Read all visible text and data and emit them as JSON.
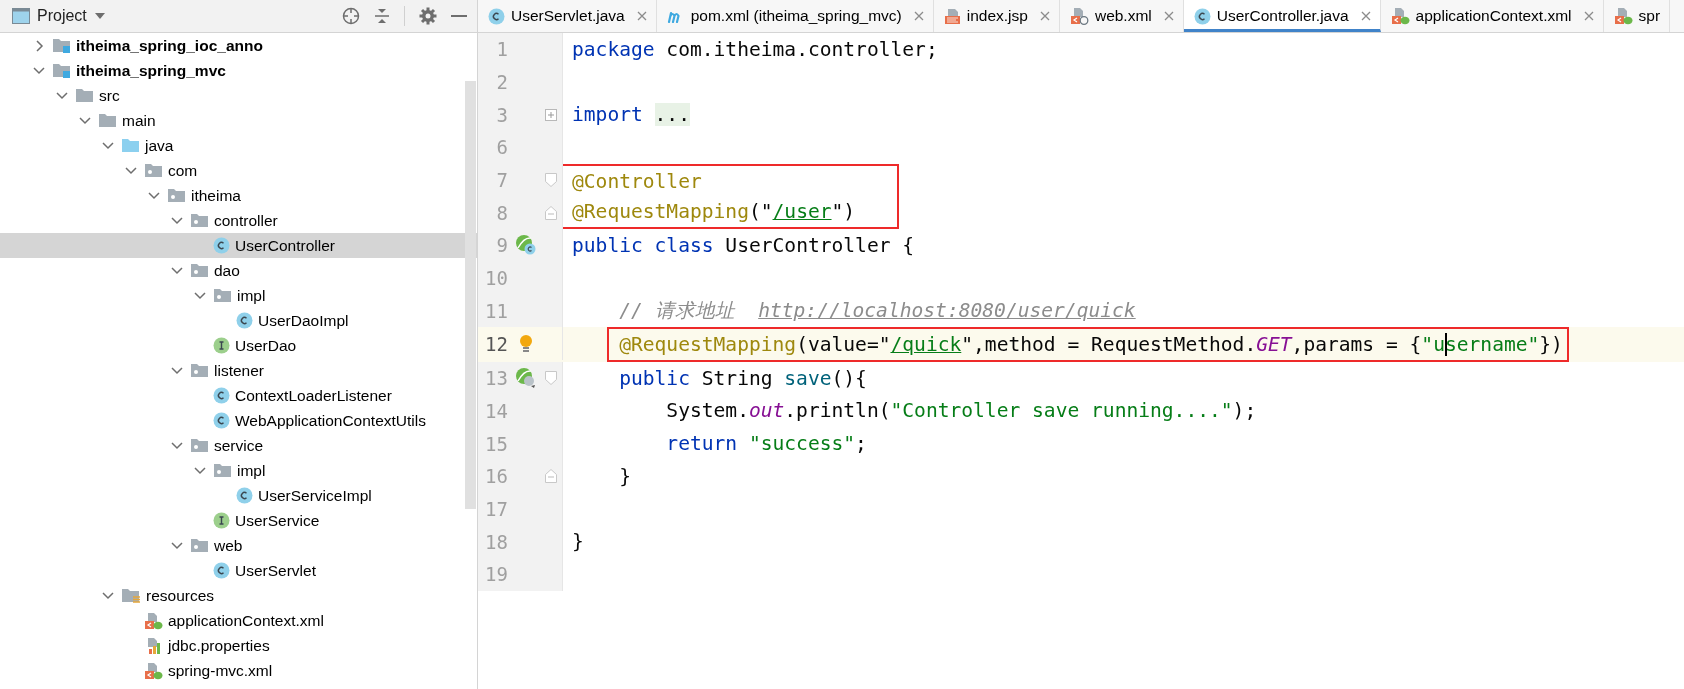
{
  "project_panel": {
    "title": "Project",
    "tree": [
      {
        "label": "itheima_spring_ioc_anno",
        "kind": "module",
        "expanded": false,
        "selected": false
      },
      {
        "label": "itheima_spring_mvc",
        "kind": "module",
        "expanded": true,
        "selected": false,
        "children": [
          {
            "label": "src",
            "kind": "folder",
            "expanded": true,
            "selected": false,
            "children": [
              {
                "label": "main",
                "kind": "folder",
                "expanded": true,
                "selected": false,
                "children": [
                  {
                    "label": "java",
                    "kind": "source-root",
                    "expanded": true,
                    "selected": false,
                    "children": [
                      {
                        "label": "com",
                        "kind": "package",
                        "expanded": true,
                        "selected": false,
                        "children": [
                          {
                            "label": "itheima",
                            "kind": "package",
                            "expanded": true,
                            "selected": false,
                            "children": [
                              {
                                "label": "controller",
                                "kind": "package",
                                "expanded": true,
                                "selected": false,
                                "children": [
                                  {
                                    "label": "UserController",
                                    "kind": "class",
                                    "selected": true
                                  }
                                ]
                              },
                              {
                                "label": "dao",
                                "kind": "package",
                                "expanded": true,
                                "selected": false,
                                "children": [
                                  {
                                    "label": "impl",
                                    "kind": "package",
                                    "expanded": true,
                                    "selected": false,
                                    "children": [
                                      {
                                        "label": "UserDaoImpl",
                                        "kind": "class",
                                        "selected": false
                                      }
                                    ]
                                  },
                                  {
                                    "label": "UserDao",
                                    "kind": "interface",
                                    "selected": false
                                  }
                                ]
                              },
                              {
                                "label": "listener",
                                "kind": "package",
                                "expanded": true,
                                "selected": false,
                                "children": [
                                  {
                                    "label": "ContextLoaderListener",
                                    "kind": "class",
                                    "selected": false
                                  },
                                  {
                                    "label": "WebApplicationContextUtils",
                                    "kind": "class",
                                    "selected": false
                                  }
                                ]
                              },
                              {
                                "label": "service",
                                "kind": "package",
                                "expanded": true,
                                "selected": false,
                                "children": [
                                  {
                                    "label": "impl",
                                    "kind": "package",
                                    "expanded": true,
                                    "selected": false,
                                    "children": [
                                      {
                                        "label": "UserServiceImpl",
                                        "kind": "class",
                                        "selected": false
                                      }
                                    ]
                                  },
                                  {
                                    "label": "UserService",
                                    "kind": "interface",
                                    "selected": false
                                  }
                                ]
                              },
                              {
                                "label": "web",
                                "kind": "package",
                                "expanded": true,
                                "selected": false,
                                "children": [
                                  {
                                    "label": "UserServlet",
                                    "kind": "class",
                                    "selected": false
                                  }
                                ]
                              }
                            ]
                          }
                        ]
                      }
                    ]
                  },
                  {
                    "label": "resources",
                    "kind": "resource-root",
                    "expanded": true,
                    "selected": false,
                    "children": [
                      {
                        "label": "applicationContext.xml",
                        "kind": "spring-xml",
                        "selected": false
                      },
                      {
                        "label": "jdbc.properties",
                        "kind": "properties",
                        "selected": false
                      },
                      {
                        "label": "spring-mvc.xml",
                        "kind": "spring-xml",
                        "selected": false
                      }
                    ]
                  }
                ]
              }
            ]
          }
        ]
      }
    ]
  },
  "tabs": [
    {
      "label": "UserServlet.java",
      "kind": "class",
      "selected": false,
      "closable": true
    },
    {
      "label": "pom.xml (itheima_spring_mvc)",
      "kind": "maven",
      "selected": false,
      "closable": true
    },
    {
      "label": "index.jsp",
      "kind": "jsp",
      "selected": false,
      "closable": true
    },
    {
      "label": "web.xml",
      "kind": "web-xml",
      "selected": false,
      "closable": true
    },
    {
      "label": "UserController.java",
      "kind": "class",
      "selected": true,
      "closable": true
    },
    {
      "label": "applicationContext.xml",
      "kind": "spring-xml",
      "selected": false,
      "closable": true
    },
    {
      "label": "spr",
      "kind": "spring-xml",
      "selected": false,
      "closable": false
    }
  ],
  "editor": {
    "lines": [
      {
        "number": "1",
        "current": false,
        "boxed": false,
        "tokens": [
          {
            "kind": "keyword",
            "text": "package"
          },
          {
            "kind": "plain",
            "text": " com.itheima.controller;"
          }
        ]
      },
      {
        "number": "2",
        "current": false,
        "boxed": false
      },
      {
        "number": "3",
        "current": false,
        "boxed": false,
        "fold_mark": {
          "kind": "collapsed"
        },
        "tokens": [
          {
            "kind": "keyword",
            "text": "import"
          },
          {
            "kind": "folded",
            "text": "..."
          }
        ]
      },
      {
        "number": "6",
        "current": false,
        "boxed": false
      },
      {
        "number": "7",
        "current": false,
        "boxed": true,
        "fold_mark": {
          "kind": "start"
        },
        "tokens": [
          {
            "kind": "annotation",
            "text": "@Controller"
          }
        ]
      },
      {
        "number": "8",
        "current": false,
        "boxed": true,
        "fold_mark": {
          "kind": "end"
        },
        "tokens": [
          {
            "kind": "annotation",
            "text": "@RequestMapping"
          },
          {
            "kind": "plain",
            "text": "(\""
          },
          {
            "kind": "url",
            "text": "/user"
          },
          {
            "kind": "plain",
            "text": "\")"
          }
        ]
      },
      {
        "number": "9",
        "current": false,
        "boxed": false,
        "gutter_icon": {
          "kind": "bean-class"
        },
        "tokens": [
          {
            "kind": "keyword",
            "text": "public class"
          },
          {
            "kind": "plain",
            "text": " UserController {"
          }
        ]
      },
      {
        "number": "10",
        "current": false,
        "boxed": false
      },
      {
        "number": "11",
        "current": false,
        "boxed": false,
        "indent": {
          "kind": "member"
        },
        "tokens": [
          {
            "kind": "comment",
            "text": "// 请求地址  "
          },
          {
            "kind": "comment-link",
            "text": "http://localhost:8080/user/quick"
          }
        ]
      },
      {
        "number": "12",
        "current": true,
        "boxed": true,
        "indent": {
          "kind": "member"
        },
        "gutter_icon": {
          "kind": "bulb"
        },
        "tokens": [
          {
            "kind": "annotation",
            "text": "@RequestMapping"
          },
          {
            "kind": "plain",
            "text": "(value=\""
          },
          {
            "kind": "url",
            "text": "/quick"
          },
          {
            "kind": "plain",
            "text": "\",method = RequestMethod."
          },
          {
            "kind": "constant",
            "text": "GET"
          },
          {
            "kind": "plain",
            "text": ",params = {"
          },
          {
            "kind": "string",
            "text": "\"u",
            "caret": true
          },
          {
            "kind": "string",
            "text": "sername\""
          },
          {
            "kind": "plain",
            "text": "})"
          }
        ]
      },
      {
        "number": "13",
        "current": false,
        "boxed": false,
        "indent": {
          "kind": "member"
        },
        "gutter_icon": {
          "kind": "bean-method"
        },
        "fold_mark": {
          "kind": "start"
        },
        "tokens": [
          {
            "kind": "keyword",
            "text": "public"
          },
          {
            "kind": "plain",
            "text": " String "
          },
          {
            "kind": "method",
            "text": "save"
          },
          {
            "kind": "plain",
            "text": "(){"
          }
        ]
      },
      {
        "number": "14",
        "current": false,
        "boxed": false,
        "indent": {
          "kind": "statement"
        },
        "tokens": [
          {
            "kind": "plain",
            "text": "System."
          },
          {
            "kind": "static",
            "text": "out"
          },
          {
            "kind": "plain",
            "text": ".println("
          },
          {
            "kind": "string",
            "text": "\"Controller save running....\""
          },
          {
            "kind": "plain",
            "text": ");"
          }
        ]
      },
      {
        "number": "15",
        "current": false,
        "boxed": false,
        "indent": {
          "kind": "statement"
        },
        "tokens": [
          {
            "kind": "keyword",
            "text": "return"
          },
          {
            "kind": "string",
            "text": " \"success\""
          },
          {
            "kind": "plain",
            "text": ";"
          }
        ]
      },
      {
        "number": "16",
        "current": false,
        "boxed": false,
        "indent": {
          "kind": "member"
        },
        "fold_mark": {
          "kind": "end"
        },
        "tokens": [
          {
            "kind": "plain",
            "text": "}"
          }
        ]
      },
      {
        "number": "17",
        "current": false,
        "boxed": false
      },
      {
        "number": "18",
        "current": false,
        "boxed": false,
        "tokens": [
          {
            "kind": "plain",
            "text": "}"
          }
        ]
      },
      {
        "number": "19",
        "current": false,
        "boxed": false
      }
    ]
  }
}
